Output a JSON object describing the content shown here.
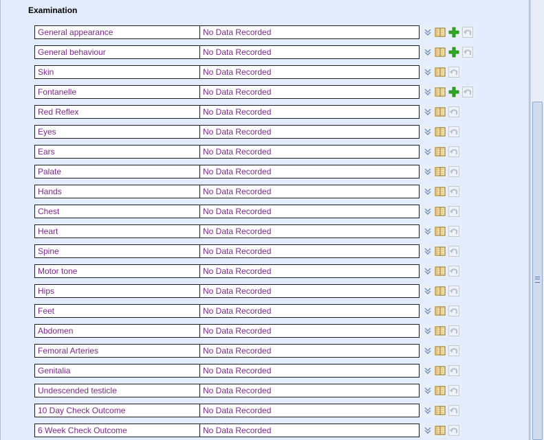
{
  "section": {
    "title": "Examination"
  },
  "rows": [
    {
      "label": "General appearance",
      "value": "No Data Recorded",
      "add": true
    },
    {
      "label": "General behaviour",
      "value": "No Data Recorded",
      "add": true
    },
    {
      "label": "Skin",
      "value": "No Data Recorded",
      "add": false
    },
    {
      "label": "Fontanelle",
      "value": "No Data Recorded",
      "add": true
    },
    {
      "label": "Red Reflex",
      "value": "No Data Recorded",
      "add": false
    },
    {
      "label": "Eyes",
      "value": "No Data Recorded",
      "add": false
    },
    {
      "label": "Ears",
      "value": "No Data Recorded",
      "add": false
    },
    {
      "label": "Palate",
      "value": "No Data Recorded",
      "add": false
    },
    {
      "label": "Hands",
      "value": "No Data Recorded",
      "add": false
    },
    {
      "label": "Chest",
      "value": "No Data Recorded",
      "add": false
    },
    {
      "label": "Heart",
      "value": "No Data Recorded",
      "add": false
    },
    {
      "label": "Spine",
      "value": "No Data Recorded",
      "add": false
    },
    {
      "label": "Motor tone",
      "value": "No Data Recorded",
      "add": false
    },
    {
      "label": "Hips",
      "value": "No Data Recorded",
      "add": false
    },
    {
      "label": "Feet",
      "value": "No Data Recorded",
      "add": false
    },
    {
      "label": "Abdomen",
      "value": "No Data Recorded",
      "add": false
    },
    {
      "label": "Femoral Arteries",
      "value": "No Data Recorded",
      "add": false
    },
    {
      "label": "Genitalia",
      "value": "No Data Recorded",
      "add": false
    },
    {
      "label": "Undescended testicle",
      "value": "No Data Recorded",
      "add": false
    },
    {
      "label": "10 Day Check Outcome",
      "value": "No Data Recorded",
      "add": false
    },
    {
      "label": "6 Week Check Outcome",
      "value": "No Data Recorded",
      "add": false
    }
  ],
  "icons": {
    "expand": "chevron-double-down-icon",
    "book": "book-icon",
    "add": "plus-icon",
    "undo": "undo-arrow-icon"
  },
  "colors": {
    "panel_bg": "#e2ecfc",
    "text_value": "#7a2a86",
    "plus_green": "#2eaa1e"
  }
}
